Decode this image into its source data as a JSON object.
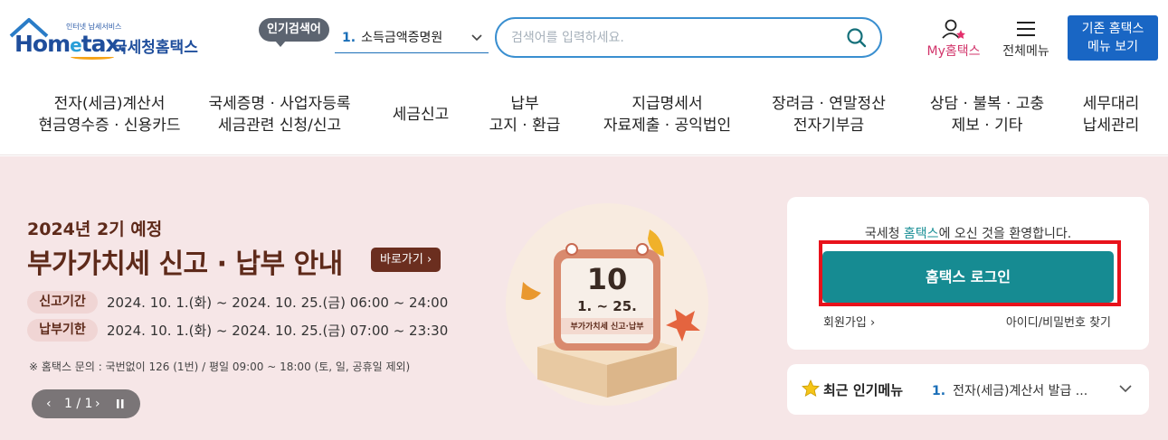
{
  "header": {
    "logo_small": "인터넷 납세서비스",
    "logo_word_a": "Hom",
    "logo_word_e": "e",
    "logo_word_b": "tax.",
    "logo_kr": "국세청홈택스",
    "popular_badge": "인기검색어",
    "popular_num": "1.",
    "popular_value": "소득금액증명원",
    "search_placeholder": "검색어를 입력하세요.",
    "my_label": "My홈택스",
    "all_menu_label": "전체메뉴",
    "old_menu_line1": "기존 홈택스",
    "old_menu_line2": "메뉴 보기"
  },
  "gnb": [
    {
      "line1": "전자(세금)계산서",
      "line2": "현금영수증 · 신용카드"
    },
    {
      "line1": "국세증명 · 사업자등록",
      "line2": "세금관련 신청/신고"
    },
    {
      "line1": "세금신고",
      "line2": ""
    },
    {
      "line1": "납부",
      "line2": "고지 · 환급"
    },
    {
      "line1": "지급명세서",
      "line2": "자료제출 · 공익법인"
    },
    {
      "line1": "장려금 · 연말정산",
      "line2": "전자기부금"
    },
    {
      "line1": "상담 · 불복 · 고충",
      "line2": "제보 · 기타"
    },
    {
      "line1": "세무대리",
      "line2": "납세관리"
    }
  ],
  "banner": {
    "subtitle": "2024년 2기 예정",
    "title": "부가가치세 신고 · 납부 안내",
    "goto_label": "바로가기",
    "rows": [
      {
        "tag": "신고기간",
        "text": "2024. 10. 1.(화) ~ 2024. 10. 25.(금) 06:00 ~ 24:00"
      },
      {
        "tag": "납부기한",
        "text": "2024. 10. 1.(화) ~ 2024. 10. 25.(금) 07:00 ~ 23:30"
      }
    ],
    "notice": "※ 홈택스 문의 : 국번없이 126 (1번) / 평일 09:00 ~ 18:00 (토, 일, 공휴일 제외)",
    "pager_text": "1 / 1",
    "calendar_day": "10",
    "calendar_range": "1. ~ 25.",
    "calendar_caption": "부가가치세 신고·납부"
  },
  "login": {
    "welcome_pre": "국세청 ",
    "welcome_hl": "홈택스",
    "welcome_post": "에 오신 것을 환영합니다.",
    "login_button": "홈택스 로그인",
    "join": "회원가입",
    "find": "아이디/비밀번호 찾기"
  },
  "recent": {
    "title": "최근 인기메뉴",
    "num": "1.",
    "value": "전자(세금)계산서 발급 ..."
  },
  "colors": {
    "brand_blue": "#1966c4",
    "teal": "#168b92",
    "banner_bg": "#f6e6e7",
    "highlight_red": "#e8121b"
  }
}
